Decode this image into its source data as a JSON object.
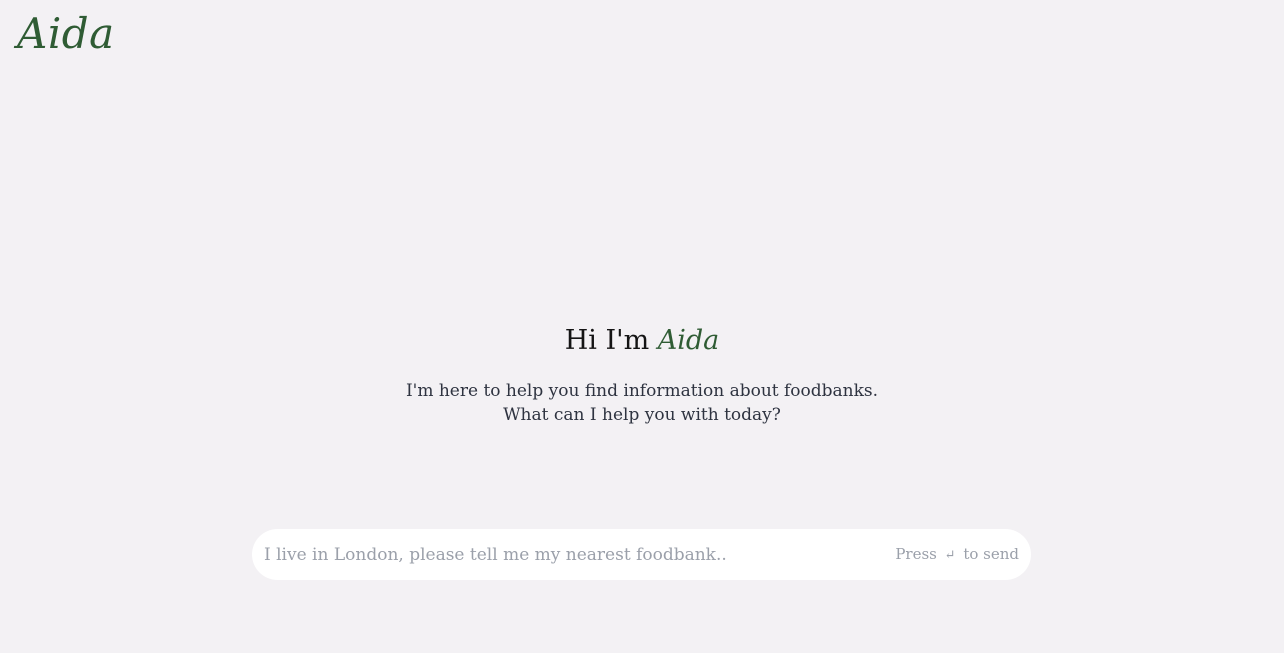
{
  "header": {
    "logo": "Aida"
  },
  "hero": {
    "title_prefix": "Hi I'm ",
    "title_brand": "Aida",
    "line1": "I'm here to help you find information about foodbanks.",
    "line2": "What can I help you with today?"
  },
  "composer": {
    "placeholder": "I live in London, please tell me my nearest foodbank..",
    "value": "",
    "hint_prefix": "Press",
    "hint_icon": "↵",
    "hint_suffix": "to send",
    "icon_name": "enter-key-icon"
  },
  "colors": {
    "background": "#f3f1f4",
    "brand_green": "#2f5c34",
    "placeholder": "#9ba0aa"
  }
}
